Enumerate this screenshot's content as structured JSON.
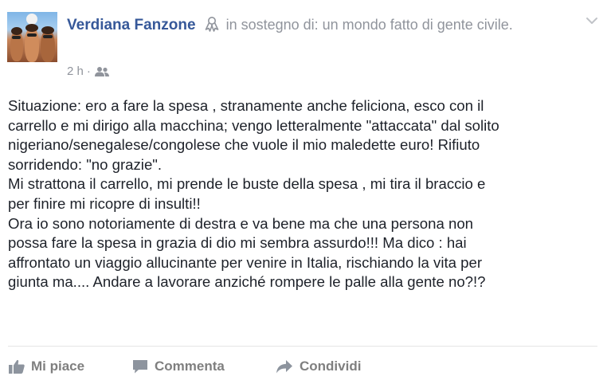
{
  "post": {
    "author": "Verdiana Fanzone",
    "support_text": "in sostegno di: un mondo fatto di gente civile.",
    "time": "2 h",
    "separator": "·",
    "audience_icon": "friends-icon",
    "body_lines": [
      "Situazione: ero a fare la spesa , stranamente anche feliciona, esco con il",
      "carrello e mi dirigo alla macchina; vengo letteralmente \"attaccata\" dal solito",
      "nigeriano/senegalese/congolese che vuole il mio maledette euro! Rifiuto",
      "sorridendo: \"no grazie\".",
      "Mi strattona il carrello, mi prende le buste della spesa , mi tira il braccio e",
      "per finire mi ricopre di insulti!!",
      "Ora io sono notoriamente di destra e va bene ma che una persona non",
      "possa fare la spesa in grazia di dio mi sembra assurdo!!! Ma dico : hai",
      "affrontato un viaggio allucinante per venire in Italia, rischiando la vita per",
      "giunta ma.... Andare a lavorare anziché rompere le palle alla gente no?!?"
    ]
  },
  "actions": {
    "like_label": "Mi piace",
    "comment_label": "Commenta",
    "share_label": "Condividi"
  },
  "colors": {
    "author": "#365899",
    "meta": "#90949c",
    "text": "#1d2129",
    "action": "#7f7f7f"
  }
}
